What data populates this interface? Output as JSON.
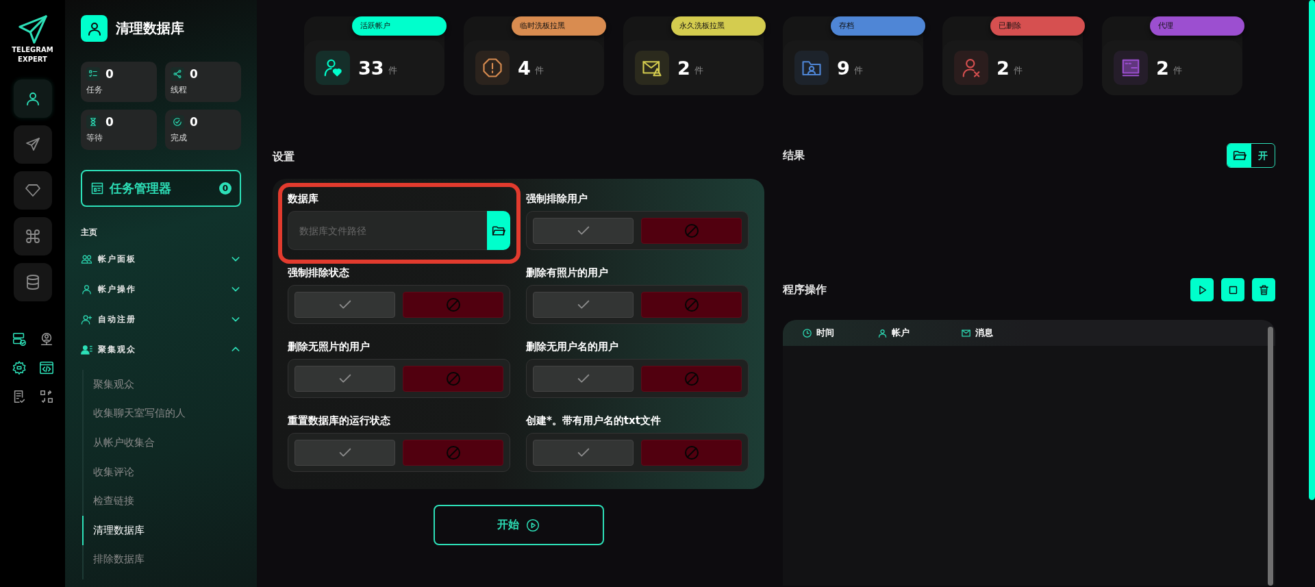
{
  "logo": {
    "lines": [
      "TELEGRAM",
      "EXPERT"
    ]
  },
  "rail": [
    {
      "kind": "user",
      "selected": true
    },
    {
      "kind": "send",
      "selected": false
    },
    {
      "kind": "diamond",
      "selected": false
    },
    {
      "kind": "command",
      "selected": false
    },
    {
      "kind": "database",
      "selected": false
    }
  ],
  "tools": [
    {
      "kind": "server",
      "active": true
    },
    {
      "kind": "person-pin",
      "active": false
    },
    {
      "kind": "gear",
      "active": true
    },
    {
      "kind": "code",
      "active": true
    },
    {
      "kind": "doc-check",
      "active": false
    },
    {
      "kind": "swap",
      "active": false
    }
  ],
  "sidebar": {
    "title": "清理数据库",
    "counters": [
      {
        "kind": "list",
        "value": "0",
        "label": "任务"
      },
      {
        "kind": "share",
        "value": "0",
        "label": "线程"
      },
      {
        "kind": "hourglass",
        "value": "0",
        "label": "等待"
      },
      {
        "kind": "check",
        "value": "0",
        "label": "完成"
      }
    ],
    "task_manager": {
      "label": "任务管理器",
      "count": "0"
    },
    "section": "主页",
    "menu": [
      {
        "kind": "users",
        "label": "帐户面板",
        "expanded": false
      },
      {
        "kind": "user",
        "label": "帐户操作",
        "expanded": false
      },
      {
        "kind": "user-plus",
        "label": "自动注册",
        "expanded": false
      },
      {
        "kind": "user-list",
        "label": "聚集观众",
        "expanded": true,
        "children": [
          {
            "label": "聚集观众",
            "selected": false
          },
          {
            "label": "收集聊天室写信的人",
            "selected": false
          },
          {
            "label": "从帐户收集合",
            "selected": false
          },
          {
            "label": "收集评论",
            "selected": false
          },
          {
            "label": "检查链接",
            "selected": false
          },
          {
            "label": "清理数据库",
            "selected": true
          },
          {
            "label": "排除数据库",
            "selected": false
          }
        ]
      }
    ]
  },
  "stats": [
    {
      "kind": "user-heart",
      "label": "活跃帐户",
      "value": "33",
      "unit": "件",
      "color": "#00ffcc"
    },
    {
      "kind": "alert",
      "label": "临时洗板拉黑",
      "value": "4",
      "unit": "件",
      "color": "#d98c50"
    },
    {
      "kind": "mail-warning",
      "label": "永久洗板拉黑",
      "value": "2",
      "unit": "件",
      "color": "#d4cc4f"
    },
    {
      "kind": "folder-user",
      "label": "存档",
      "value": "9",
      "unit": "件",
      "color": "#4f86d6"
    },
    {
      "kind": "user-x",
      "label": "已删除",
      "value": "2",
      "unit": "件",
      "color": "#d65050"
    },
    {
      "kind": "window",
      "label": "代理",
      "value": "2",
      "unit": "件",
      "color": "#9c4fd0"
    }
  ],
  "settings": {
    "title": "设置",
    "database": {
      "label": "数据库",
      "placeholder": "数据库文件路径",
      "highlighted": true
    },
    "options": [
      {
        "label": "强制排除用户",
        "on": false
      },
      {
        "label": "强制排除状态",
        "on": false
      },
      {
        "label": "删除有照片的用户",
        "on": false
      },
      {
        "label": "删除无照片的用户",
        "on": false
      },
      {
        "label": "删除无用户名的用户",
        "on": false
      },
      {
        "label": "重置数据库的运行状态",
        "on": false
      },
      {
        "label": "创建*。带有用户名的txt文件",
        "on": false
      }
    ]
  },
  "start_button": {
    "label": "开始"
  },
  "results": {
    "title": "结果",
    "open_button": "开"
  },
  "log": {
    "title": "程序操作",
    "actions": [
      {
        "kind": "play"
      },
      {
        "kind": "stop"
      },
      {
        "kind": "delete"
      }
    ],
    "columns": [
      {
        "kind": "time",
        "label": "时间"
      },
      {
        "kind": "account",
        "label": "帐户"
      },
      {
        "kind": "message",
        "label": "消息"
      }
    ]
  }
}
